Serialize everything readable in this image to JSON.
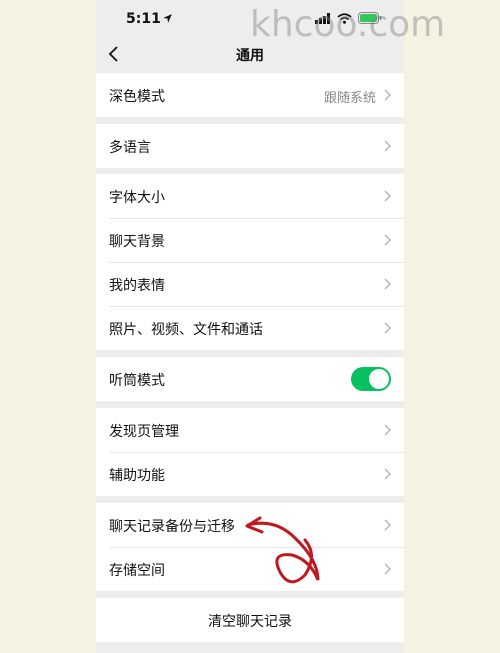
{
  "status": {
    "time": "5:11"
  },
  "watermark": "khcoo.com",
  "nav": {
    "title": "通用"
  },
  "groups": {
    "dark": {
      "label": "深色模式",
      "value": "跟随系统"
    },
    "language": {
      "label": "多语言"
    },
    "font_size": {
      "label": "字体大小"
    },
    "chat_bg": {
      "label": "聊天背景"
    },
    "stickers": {
      "label": "我的表情"
    },
    "media": {
      "label": "照片、视频、文件和通话"
    },
    "earpiece": {
      "label": "听筒模式",
      "enabled": true
    },
    "discover": {
      "label": "发现页管理"
    },
    "accessibility": {
      "label": "辅助功能"
    },
    "backup": {
      "label": "聊天记录备份与迁移"
    },
    "storage": {
      "label": "存储空间"
    }
  },
  "clear_button": {
    "label": "清空聊天记录"
  },
  "colors": {
    "accent": "#07c160",
    "annotation": "#c0181f",
    "page_bg": "#ededed"
  },
  "icons": [
    "location-arrow-icon",
    "signal-icon",
    "wifi-icon",
    "battery-icon",
    "back-icon",
    "chevron-right-icon"
  ]
}
